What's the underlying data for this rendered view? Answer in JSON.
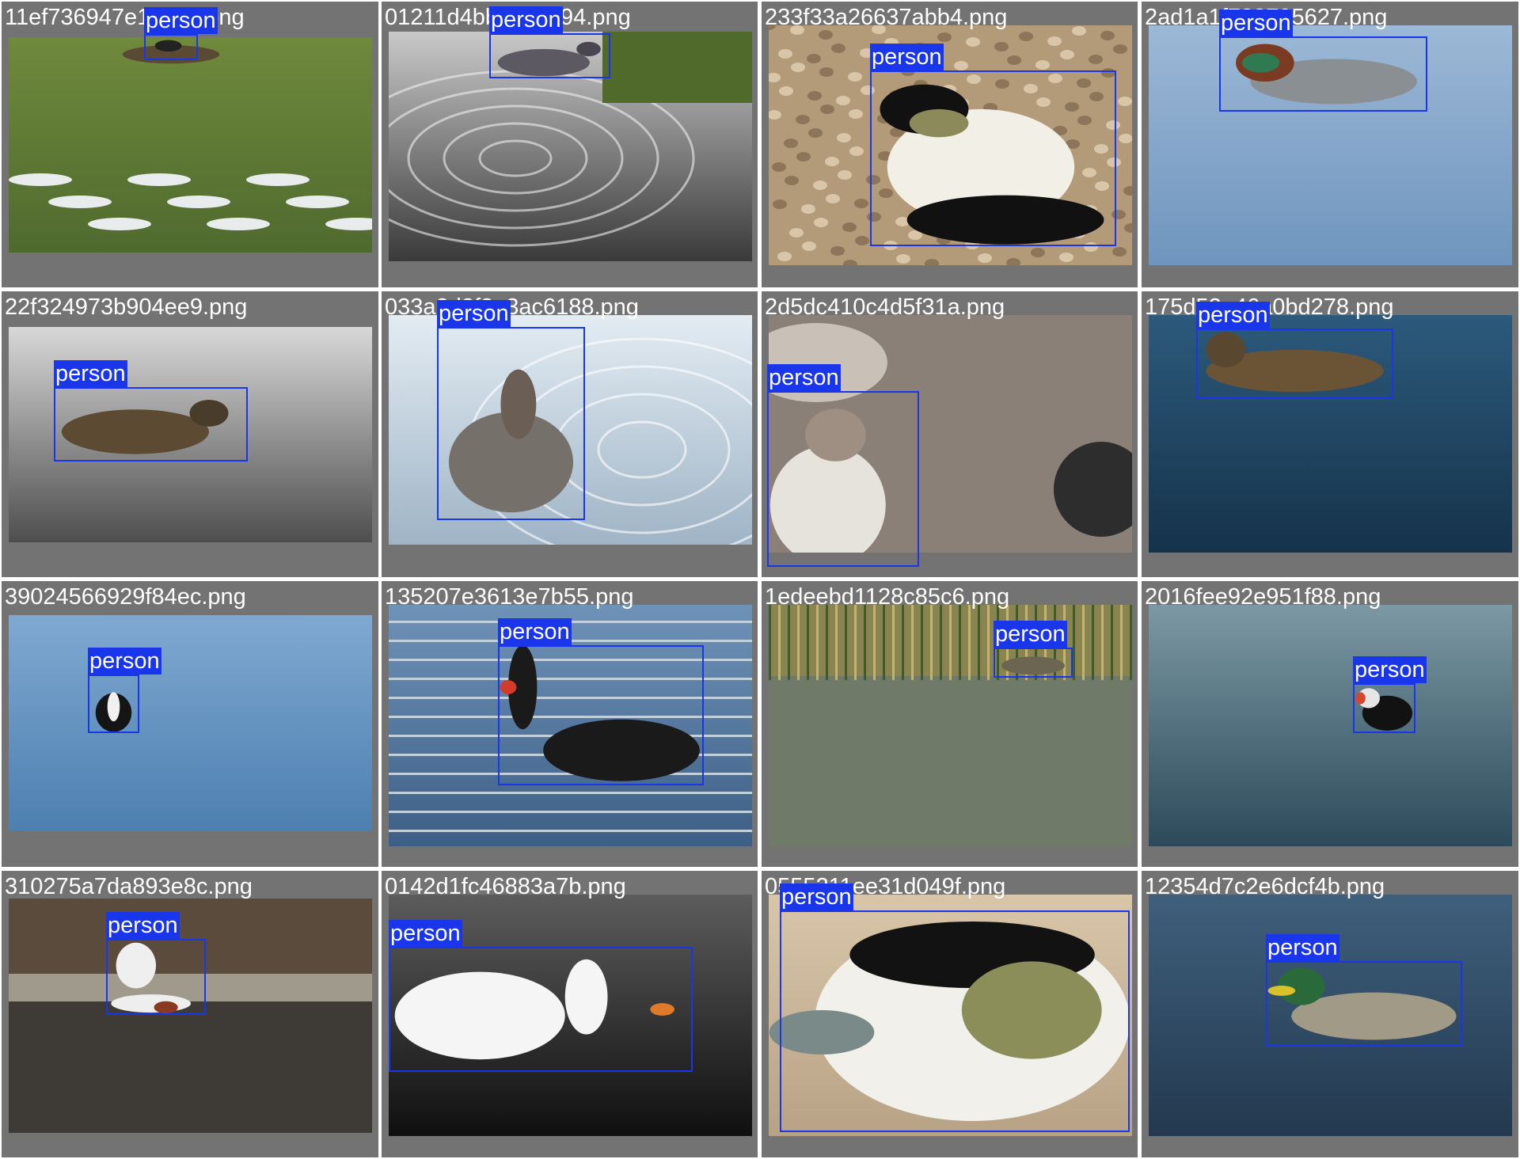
{
  "tiles": [
    {
      "filename": "11ef736947e18c52.png",
      "label": "person",
      "scene": "green-lake",
      "subject": "nest-coot"
    },
    {
      "filename": "01211d4bbc161694.png",
      "label": "person",
      "scene": "ripple-water",
      "subject": "grey-bird"
    },
    {
      "filename": "233f33a26637abb4.png",
      "label": "person",
      "scene": "pebbles",
      "subject": "eider"
    },
    {
      "filename": "2ad1a1f723795627.png",
      "label": "person",
      "scene": "blue-water",
      "subject": "teal"
    },
    {
      "filename": "22f324973b904ee9.png",
      "label": "person",
      "scene": "grey-water",
      "subject": "brown-duck"
    },
    {
      "filename": "033a2d2f2e3ac6188.png",
      "label": "person",
      "scene": "ripple-blue",
      "subject": "goose"
    },
    {
      "filename": "2d5dc410c4d5f31a.png",
      "label": "person",
      "scene": "rocks",
      "subject": "booby"
    },
    {
      "filename": "175d52a46a0bd278.png",
      "label": "person",
      "scene": "dark-water",
      "subject": "mallard-hens"
    },
    {
      "filename": "39024566929f84ec.png",
      "label": "person",
      "scene": "light-blue-water",
      "subject": "loon"
    },
    {
      "filename": "135207e3613e7b55.png",
      "label": "person",
      "scene": "blue-ripple",
      "subject": "black-swan"
    },
    {
      "filename": "1edeebd1128c85c6.png",
      "label": "person",
      "scene": "reeds",
      "subject": "hidden-duck"
    },
    {
      "filename": "2016fee92e951f88.png",
      "label": "person",
      "scene": "teal-water",
      "subject": "puffin"
    },
    {
      "filename": "310275a7da893e8c.png",
      "label": "person",
      "scene": "shore",
      "subject": "mergansers"
    },
    {
      "filename": "0142d1fc46883a7b.png",
      "label": "person",
      "scene": "black-water",
      "subject": "mute-swan"
    },
    {
      "filename": "0555211ee31d049f.png",
      "label": "person",
      "scene": "closeup",
      "subject": "eider-head"
    },
    {
      "filename": "12354d7c2e6dcf4b.png",
      "label": "person",
      "scene": "deep-blue",
      "subject": "mallard-drake"
    }
  ],
  "colors": {
    "tile_bg": "#737373",
    "box": "#1a36ea",
    "label_text": "#ffffff"
  }
}
